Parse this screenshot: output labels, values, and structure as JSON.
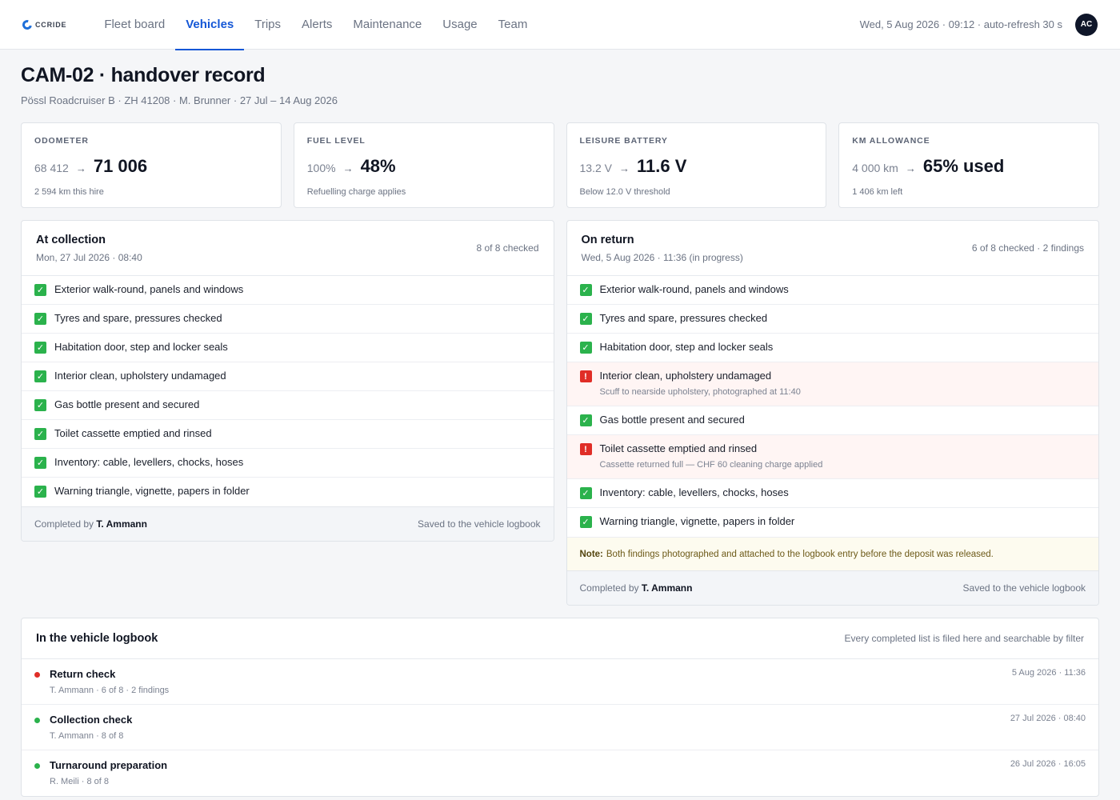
{
  "app": {
    "logo_text": "CCRIDE"
  },
  "nav": [
    {
      "label": "Fleet board",
      "active": false
    },
    {
      "label": "Vehicles",
      "active": true
    },
    {
      "label": "Trips",
      "active": false
    },
    {
      "label": "Alerts",
      "active": false
    },
    {
      "label": "Maintenance",
      "active": false
    },
    {
      "label": "Usage",
      "active": false
    },
    {
      "label": "Team",
      "active": false
    }
  ],
  "header": {
    "clock": "Wed, 5 Aug 2026 · 09:12 · auto-refresh 30 s",
    "avatar_initials": "AC"
  },
  "page": {
    "title": "CAM-02 · handover record",
    "subtitle": "Pössl Roadcruiser B · ZH 41208 · M. Brunner · 27 Jul – 14 Aug 2026"
  },
  "kpis": [
    {
      "label": "ODOMETER",
      "from": "68 412",
      "to": "71 006",
      "note": "2 594 km this hire"
    },
    {
      "label": "FUEL LEVEL",
      "from": "100%",
      "to": "48%",
      "note": "Refuelling charge applies"
    },
    {
      "label": "LEISURE BATTERY",
      "from": "13.2 V",
      "to": "11.6 V",
      "note": "Below 12.0 V threshold"
    },
    {
      "label": "KM ALLOWANCE",
      "from": "4 000 km",
      "to": "65% used",
      "note": "1 406 km left"
    }
  ],
  "arrow_glyph": "→",
  "collection": {
    "title": "At collection",
    "date": "Mon, 27 Jul 2026 · 08:40",
    "count": "8 of 8 checked",
    "items": [
      {
        "text": "Exterior walk-round, panels and windows",
        "status": "ok"
      },
      {
        "text": "Tyres and spare, pressures checked",
        "status": "ok"
      },
      {
        "text": "Habitation door, step and locker seals",
        "status": "ok"
      },
      {
        "text": "Interior clean, upholstery undamaged",
        "status": "ok"
      },
      {
        "text": "Gas bottle present and secured",
        "status": "ok"
      },
      {
        "text": "Toilet cassette emptied and rinsed",
        "status": "ok"
      },
      {
        "text": "Inventory: cable, levellers, chocks, hoses",
        "status": "ok"
      },
      {
        "text": "Warning triangle, vignette, papers in folder",
        "status": "ok"
      }
    ],
    "footer_prefix": "Completed by",
    "footer_name": "T. Ammann",
    "footer_right": "Saved to the vehicle logbook"
  },
  "return": {
    "title": "On return",
    "date": "Wed, 5 Aug 2026 · 11:36 (in progress)",
    "count": "6 of 8 checked · 2 findings",
    "items": [
      {
        "text": "Exterior walk-round, panels and windows",
        "status": "ok",
        "detail": ""
      },
      {
        "text": "Tyres and spare, pressures checked",
        "status": "ok",
        "detail": ""
      },
      {
        "text": "Habitation door, step and locker seals",
        "status": "ok",
        "detail": ""
      },
      {
        "text": "Interior clean, upholstery undamaged",
        "status": "fail",
        "detail": "Scuff to nearside upholstery, photographed at 11:40"
      },
      {
        "text": "Gas bottle present and secured",
        "status": "ok",
        "detail": ""
      },
      {
        "text": "Toilet cassette emptied and rinsed",
        "status": "fail",
        "detail": "Cassette returned full — CHF 60 cleaning charge applied"
      },
      {
        "text": "Inventory: cable, levellers, chocks, hoses",
        "status": "ok",
        "detail": ""
      },
      {
        "text": "Warning triangle, vignette, papers in folder",
        "status": "ok",
        "detail": ""
      }
    ],
    "note_label": "Note:",
    "note_text": "Both findings photographed and attached to the logbook entry before the deposit was released.",
    "footer_prefix": "Completed by",
    "footer_name": "T. Ammann",
    "footer_right": "Saved to the vehicle logbook"
  },
  "logbook": {
    "title": "In the vehicle logbook",
    "hint": "Every completed list is filed here and searchable by filter",
    "entries": [
      {
        "name": "Return check",
        "meta": "T. Ammann · 6 of 8 · 2 findings",
        "time": "5 Aug 2026 · 11:36",
        "status_color": "#e02e27"
      },
      {
        "name": "Collection check",
        "meta": "T. Ammann · 8 of 8",
        "time": "27 Jul 2026 · 08:40",
        "status_color": "#2bb24c"
      },
      {
        "name": "Turnaround preparation",
        "meta": "R. Meili · 8 of 8",
        "time": "26 Jul 2026 · 16:05",
        "status_color": "#2bb24c"
      }
    ]
  },
  "glyphs": {
    "ok": "✓",
    "fail": "!"
  }
}
